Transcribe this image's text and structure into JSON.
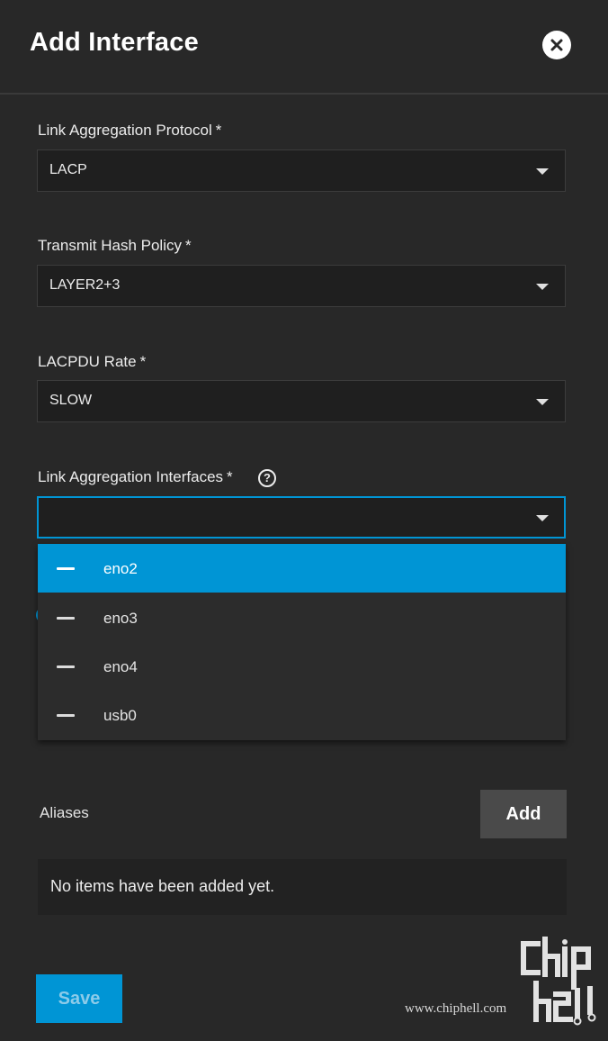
{
  "dialog": {
    "title": "Add Interface",
    "close_icon": "close-icon"
  },
  "fields": {
    "lag_protocol": {
      "label": "Link Aggregation Protocol",
      "required": "*",
      "value": "LACP"
    },
    "xmit_hash": {
      "label": "Transmit Hash Policy",
      "required": "*",
      "value": "LAYER2+3"
    },
    "lacpdu_rate": {
      "label": "LACPDU Rate",
      "required": "*",
      "value": "SLOW"
    },
    "lag_interfaces": {
      "label": "Link Aggregation Interfaces",
      "required": "*",
      "help_icon": "help-circle-icon",
      "help_glyph": "?",
      "value": "",
      "options": [
        {
          "label": "eno2",
          "highlighted": true
        },
        {
          "label": "eno3",
          "highlighted": false
        },
        {
          "label": "eno4",
          "highlighted": false
        },
        {
          "label": "usb0",
          "highlighted": false
        }
      ]
    }
  },
  "aliases": {
    "label": "Aliases",
    "add_label": "Add",
    "empty_text": "No items have been added yet."
  },
  "footer": {
    "save_label": "Save"
  },
  "watermark": {
    "site": "www.chiphell.com",
    "logo_text": "chip hell"
  },
  "colors": {
    "background": "#282828",
    "accent": "#0095d5",
    "input_bg": "#1f1f1f",
    "button_gray": "#4a4a4a"
  }
}
